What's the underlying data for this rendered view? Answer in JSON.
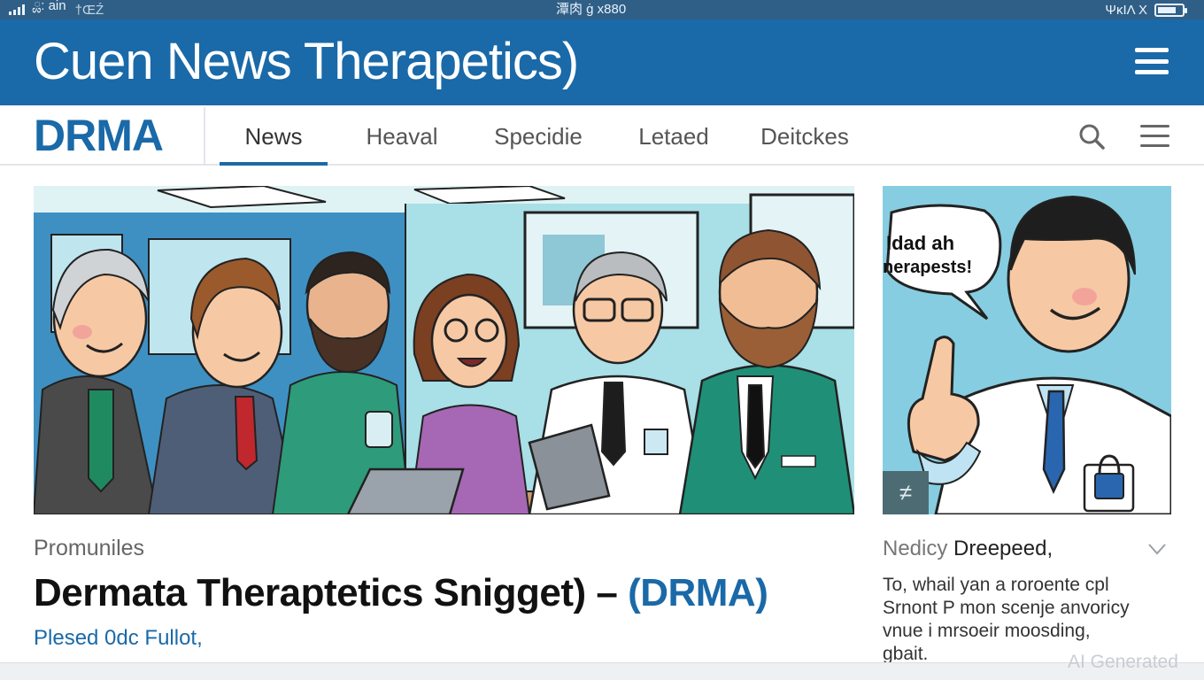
{
  "status_bar": {
    "carrier": "ྏ: ain",
    "carrier_extra": "†ŒŹ",
    "time": "潭肉 ġ х880",
    "battery_text": "ΨκΙΛ Χ",
    "battery_level": 0.75
  },
  "header": {
    "title": "Cuen News Therapetics)",
    "menu_icon": "hamburger-icon"
  },
  "nav": {
    "logo": "DRMA",
    "tabs": [
      {
        "label": "News",
        "active": true
      },
      {
        "label": "Heaval",
        "active": false
      },
      {
        "label": "Specidie",
        "active": false
      },
      {
        "label": "Letaed",
        "active": false
      },
      {
        "label": "Deitckes",
        "active": false
      }
    ],
    "search_icon": "search-icon",
    "menu_icon": "hamburger-icon"
  },
  "hero": {
    "image": "group-of-doctors-and-businesspeople-illustration"
  },
  "side_card": {
    "image": "doctor-pointing-illustration",
    "speech_bubble_line1": "Idad ah",
    "speech_bubble_line2": "nerapests!",
    "badge_icon": "tag-icon",
    "title_muted": "Nedicy",
    "title_main": "Dreepeed,",
    "chevron_icon": "chevron-down-icon",
    "body_lines": [
      "To, whail yan a roroente cpl",
      "Srnont P mon scenje anvoricy",
      "vnue i mrsoeir moosding,",
      "gbait."
    ]
  },
  "article": {
    "kicker": "Promuniles",
    "headline_main": "Dermata Theraptetics Snigget) – ",
    "headline_ticker": "(DRMA)",
    "byline": "Plesed 0dc Fullot,"
  },
  "watermark": "AI Generated",
  "colors": {
    "brand_blue": "#1a69a8",
    "status_bar": "#2f5f86"
  }
}
